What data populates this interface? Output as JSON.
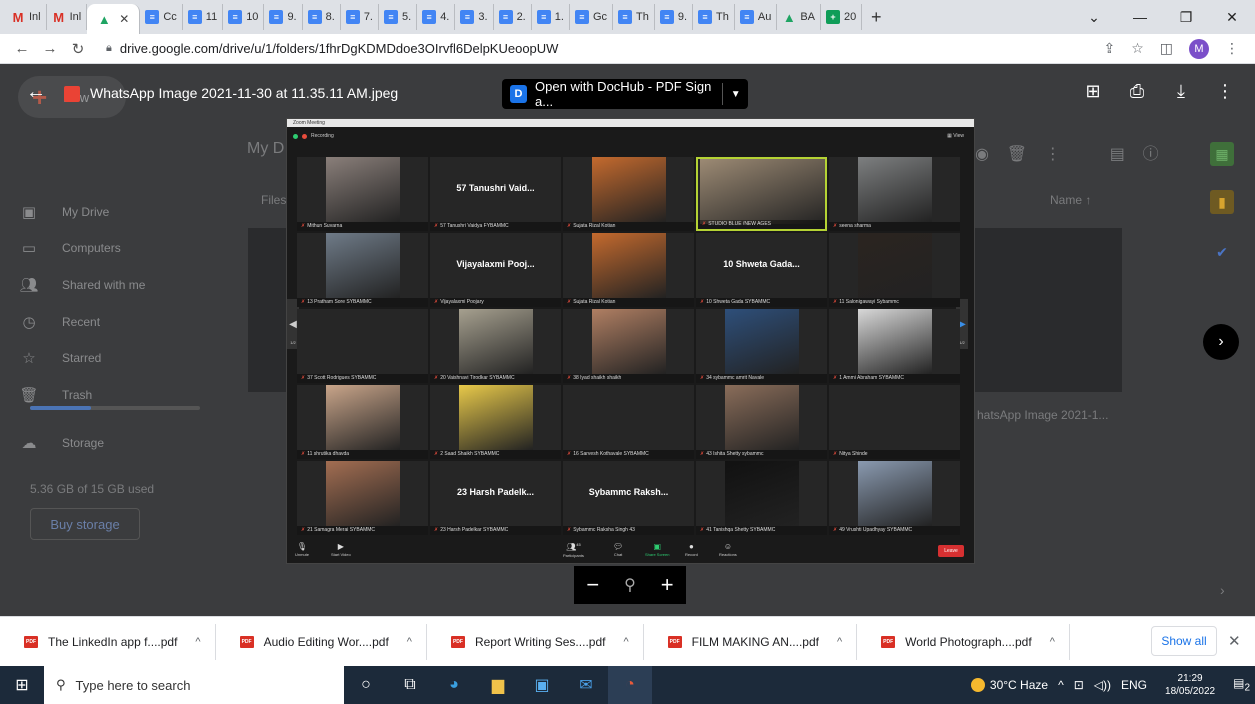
{
  "browser": {
    "tabs": [
      {
        "label": "Inl",
        "icon": "gmail-icon"
      },
      {
        "label": "Inl",
        "icon": "gmail-icon"
      },
      {
        "label": "",
        "icon": "drive-icon",
        "active": true
      },
      {
        "label": "Cc",
        "icon": "doc-icon"
      },
      {
        "label": "11",
        "icon": "doc-icon"
      },
      {
        "label": "10",
        "icon": "doc-icon"
      },
      {
        "label": "9.",
        "icon": "doc-icon"
      },
      {
        "label": "8.",
        "icon": "doc-icon"
      },
      {
        "label": "7.",
        "icon": "doc-icon"
      },
      {
        "label": "5.",
        "icon": "doc-icon"
      },
      {
        "label": "4.",
        "icon": "doc-icon"
      },
      {
        "label": "3.",
        "icon": "doc-icon"
      },
      {
        "label": "2.",
        "icon": "doc-icon"
      },
      {
        "label": "1.",
        "icon": "doc-icon"
      },
      {
        "label": "Gc",
        "icon": "doc-icon"
      },
      {
        "label": "Th",
        "icon": "doc-icon"
      },
      {
        "label": "9.",
        "icon": "doc-icon"
      },
      {
        "label": "Th",
        "icon": "doc-icon"
      },
      {
        "label": "Au",
        "icon": "doc-icon"
      },
      {
        "label": "BA",
        "icon": "drive-icon"
      },
      {
        "label": "20",
        "icon": "sheet-icon"
      }
    ],
    "url": "drive.google.com/drive/u/1/folders/1fhrDgKDMDdoe3OIrvfl6DelpKUeoopUW",
    "profile_initial": "M"
  },
  "drive": {
    "new_label": "New",
    "sidebar": [
      {
        "label": "My Drive",
        "icon": "my-drive-icon"
      },
      {
        "label": "Computers",
        "icon": "computer-icon"
      },
      {
        "label": "Shared with me",
        "icon": "people-icon"
      },
      {
        "label": "Recent",
        "icon": "clock-icon"
      },
      {
        "label": "Starred",
        "icon": "star-icon"
      },
      {
        "label": "Trash",
        "icon": "trash-icon"
      }
    ],
    "storage_label": "Storage",
    "storage_used": "5.36 GB of 15 GB used",
    "storage_fraction": 0.357,
    "buy_storage": "Buy storage",
    "breadcrumb": "My D",
    "files_label": "Files",
    "sort_label": "Name",
    "bg_file_name": "hatsApp Image 2021-1..."
  },
  "viewer": {
    "file_title": "WhatsApp Image 2021-11-30 at 11.35.11 AM.jpeg",
    "open_with": "Open with DocHub - PDF Sign a..."
  },
  "zoom_meeting": {
    "window_title": "Zoom Meeting",
    "recording": "Recording",
    "view_label": "View",
    "tiles": [
      {
        "name": "Mithun Suvarna",
        "kind": "photo",
        "color": "#8a7f7a"
      },
      {
        "name": "57 Tanushri Vaidya FYBAMMC",
        "big": "57 Tanushri Vaid...",
        "kind": "text"
      },
      {
        "name": "Sujata Rizal Kotian",
        "kind": "photo",
        "color": "#c46a2e"
      },
      {
        "name": "STUDIO BLUE /NEW AGES",
        "kind": "photo",
        "color": "#9c8a74",
        "speaking": true
      },
      {
        "name": "seena sharma",
        "kind": "photo",
        "color": "#7d7f80"
      },
      {
        "name": "13 Pratham Sore SYBAMMC",
        "kind": "photo",
        "color": "#6f7b88"
      },
      {
        "name": "Vijayalaxmi Poojary",
        "big": "Vijayalaxmi Pooj...",
        "kind": "text"
      },
      {
        "name": "Sujata Rizal Kotian",
        "kind": "photo",
        "color": "#c46a2e"
      },
      {
        "name": "10 Shweta Gada SYBAMMC",
        "big": "10 Shweta Gada...",
        "kind": "text"
      },
      {
        "name": "11 Salonigawayi Sybammc",
        "kind": "photo",
        "color": "#2b2420"
      },
      {
        "name": "37 Scott Rodrigues SYBAMMC",
        "kind": "dark"
      },
      {
        "name": "20 Vaishnavi Tirodkar SYBAMMC",
        "kind": "photo",
        "color": "#a6a08f"
      },
      {
        "name": "38 Iyad shaikh shaikh",
        "kind": "photo",
        "color": "#b07f63"
      },
      {
        "name": "34 sybammc amrit Navale",
        "kind": "photo",
        "color": "#2e4f7a"
      },
      {
        "name": "1 Ammi Abraham SYBAMMC",
        "kind": "photo",
        "color": "#d8d8d8"
      },
      {
        "name": "11 shrutika dhavda",
        "kind": "photo",
        "color": "#c9a58a"
      },
      {
        "name": "2 Saad Shaikh SYBAMMC",
        "kind": "photo",
        "color": "#e8c94a"
      },
      {
        "name": "16 Sarvesh Kothavale SYBAMMC",
        "kind": "dark"
      },
      {
        "name": "43 Ishita Shetty sybammc",
        "kind": "photo",
        "color": "#8a6d5a"
      },
      {
        "name": "Nitya Shinde",
        "kind": "dark"
      },
      {
        "name": "21 Samagra Merai SYBAMMC",
        "kind": "photo",
        "color": "#a36e52"
      },
      {
        "name": "23 Harsh Padelkar SYBAMMC",
        "big": "23 Harsh Padelk...",
        "kind": "text"
      },
      {
        "name": "Sybammc Raksha Singh 43",
        "big": "Sybammc Raksh...",
        "kind": "text"
      },
      {
        "name": "41 Tanishqa Shetty SYBAMMC",
        "kind": "photo",
        "color": "#111111"
      },
      {
        "name": "49 Vrushti Upadhyay SYBAMMC",
        "kind": "photo",
        "color": "#8a9ab0"
      }
    ],
    "page_left": "1/2",
    "page_right": "1/2",
    "controls": [
      {
        "label": "Unmute",
        "icon": "mic-muted-icon"
      },
      {
        "label": "Start Video",
        "icon": "video-off-icon"
      },
      {
        "label": "Participants",
        "icon": "participants-icon",
        "count": "45"
      },
      {
        "label": "Chat",
        "icon": "chat-icon"
      },
      {
        "label": "Share Screen",
        "icon": "share-screen-icon"
      },
      {
        "label": "Record",
        "icon": "record-icon"
      },
      {
        "label": "Reactions",
        "icon": "reactions-icon"
      }
    ],
    "leave": "Leave"
  },
  "downloads": [
    {
      "name": "The LinkedIn app f....pdf"
    },
    {
      "name": "Audio Editing Wor....pdf"
    },
    {
      "name": "Report Writing Ses....pdf"
    },
    {
      "name": "FILM MAKING AN....pdf"
    },
    {
      "name": "World Photograph....pdf"
    }
  ],
  "downloads_show_all": "Show all",
  "pdf_badge": "PDF",
  "taskbar": {
    "search_placeholder": "Type here to search",
    "weather": "30°C Haze",
    "language": "ENG",
    "time": "21:29",
    "date": "18/05/2022",
    "notifications": "2"
  }
}
